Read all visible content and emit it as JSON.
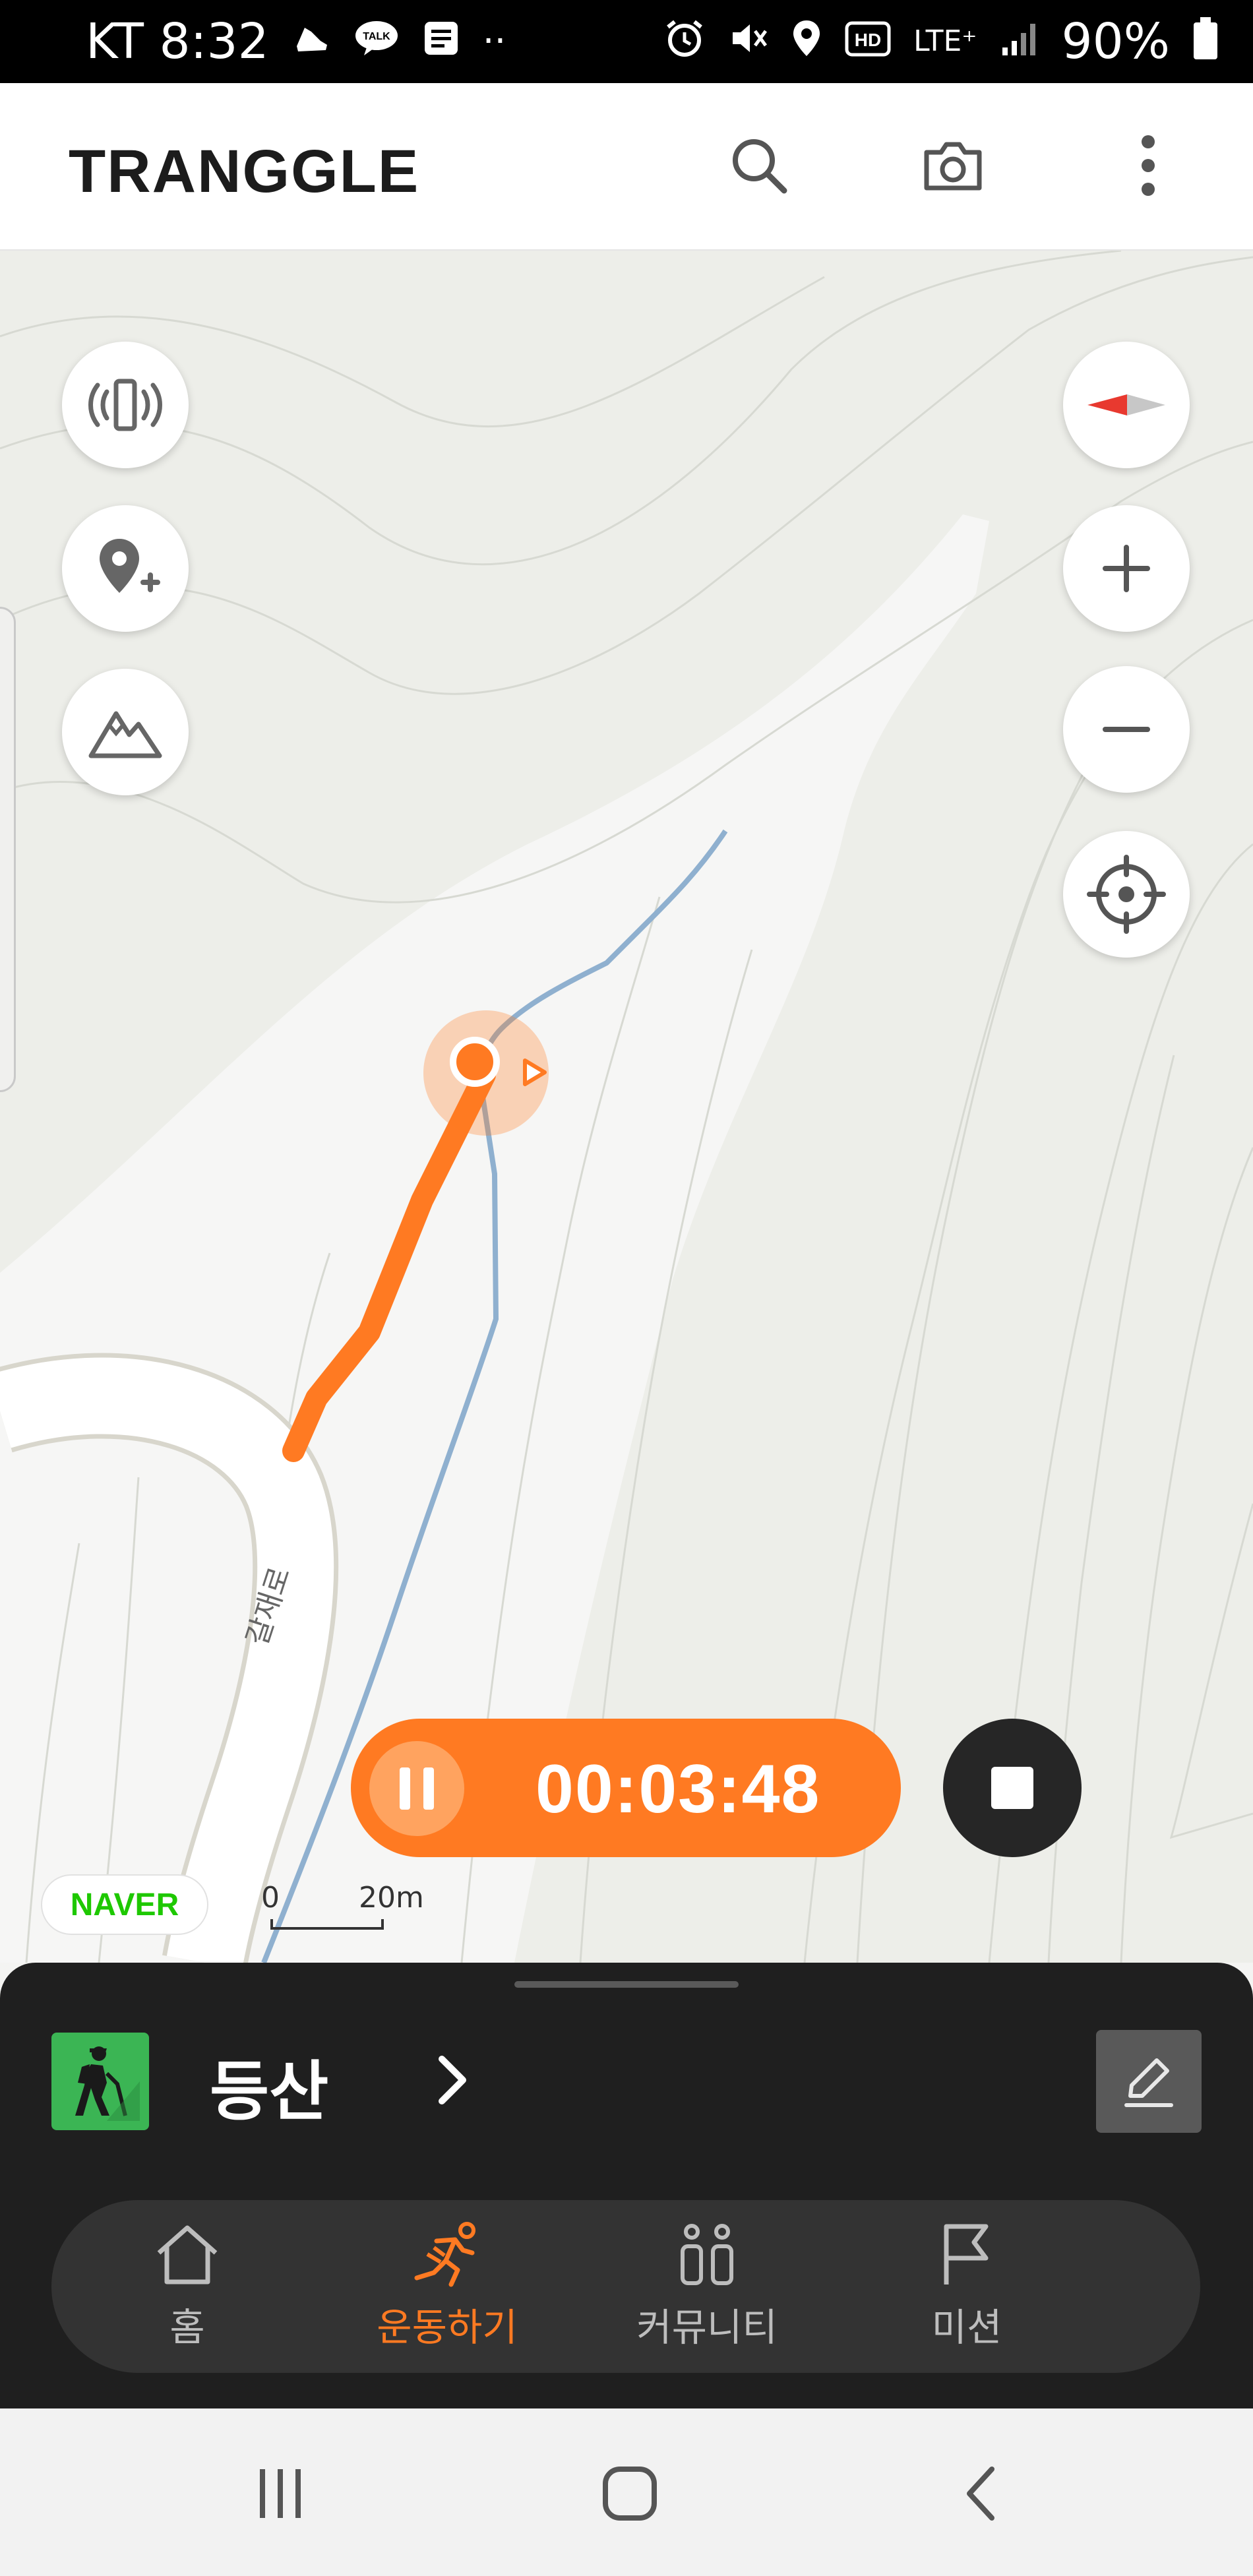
{
  "status_bar": {
    "time": "KT 8:32",
    "network": "LTE⁺",
    "battery": "90%",
    "dots": "··"
  },
  "app": {
    "logo": "TRANGGLE"
  },
  "map": {
    "road_label": "갈재로",
    "provider": "NAVER",
    "scale_start": "0",
    "scale_end": "20m",
    "track_color": "#ff7a22",
    "trail_color": "#8fb0cf"
  },
  "timer": {
    "elapsed": "00:03:48"
  },
  "activity": {
    "label": "등산"
  },
  "bottom_nav": {
    "items": [
      {
        "label": "홈",
        "icon": "home-icon",
        "active": false
      },
      {
        "label": "운동하기",
        "icon": "running-icon",
        "active": true
      },
      {
        "label": "커뮤니티",
        "icon": "people-icon",
        "active": false
      },
      {
        "label": "미션",
        "icon": "flag-icon",
        "active": false
      }
    ]
  },
  "colors": {
    "accent": "#ff7a22",
    "activity_green": "#3bb554",
    "panel_dark": "#1f1f1f",
    "naver_green": "#1ec800"
  }
}
